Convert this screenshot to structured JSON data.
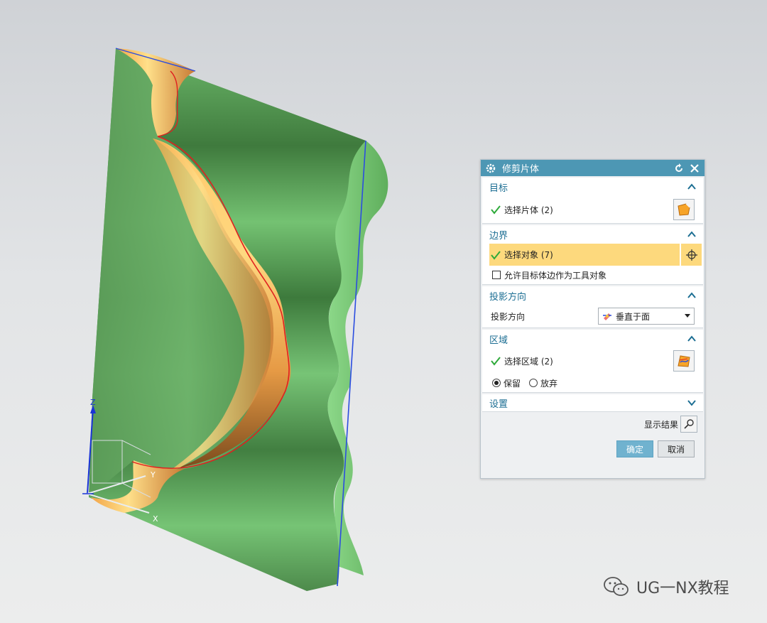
{
  "dialog": {
    "title": "修剪片体",
    "groups": {
      "target": {
        "heading": "目标",
        "select_label": "选择片体 (2)"
      },
      "boundary": {
        "heading": "边界",
        "select_label": "选择对象 (7)",
        "allow_checkbox": "允许目标体边作为工具对象",
        "allow_checked": false
      },
      "projection": {
        "heading": "投影方向",
        "row_label": "投影方向",
        "dropdown_value": "垂直于面"
      },
      "region": {
        "heading": "区域",
        "select_label": "选择区域 (2)",
        "keep_label": "保留",
        "discard_label": "放弃",
        "selected": "保留"
      },
      "settings": {
        "heading": "设置",
        "collapsed": true
      }
    },
    "show_result_label": "显示结果",
    "ok_label": "确定",
    "cancel_label": "取消"
  },
  "triad": {
    "z": "Z",
    "y": "Y",
    "x": "X"
  },
  "watermark": {
    "text": "UG一NX教程"
  },
  "colors": {
    "title_bar": "#4d97b4",
    "group_heading": "#1c6e93",
    "selection_highlight": "#fdd97d",
    "ok_button": "#70b2cf",
    "sheet_green": "#5b9c58",
    "sheet_edge_orange": "#f4a444",
    "curve_blue": "#2b4de0",
    "boundary_red": "#e02020"
  }
}
